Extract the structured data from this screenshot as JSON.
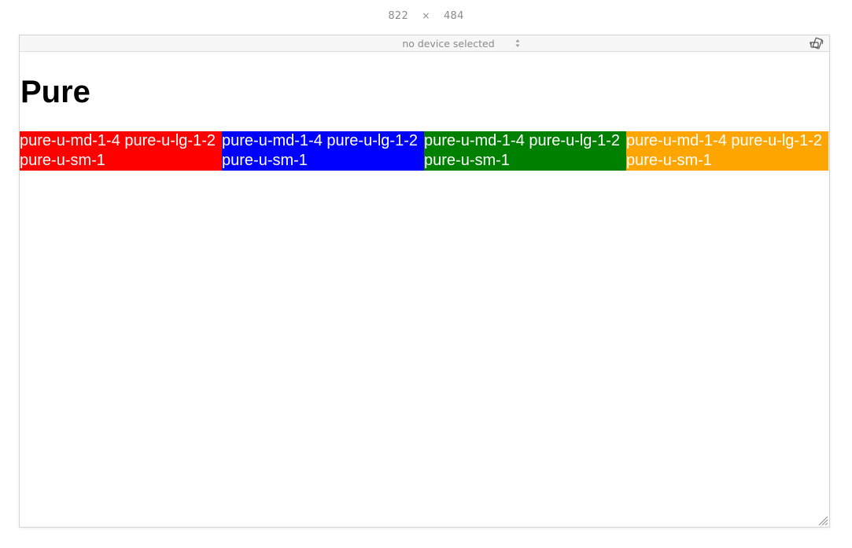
{
  "responsive_bar": {
    "width": "822",
    "separator": "×",
    "height": "484",
    "device_select": "no device selected"
  },
  "page": {
    "title": "Pure",
    "cells": [
      {
        "line1": "pure-u-md-1-4 pure-u-lg-1-2",
        "line2": "pure-u-sm-1",
        "color": "#ff0000"
      },
      {
        "line1": "pure-u-md-1-4 pure-u-lg-1-2",
        "line2": "pure-u-sm-1",
        "color": "#0000ff"
      },
      {
        "line1": "pure-u-md-1-4 pure-u-lg-1-2",
        "line2": "pure-u-sm-1",
        "color": "#008000"
      },
      {
        "line1": "pure-u-md-1-4 pure-u-lg-1-2",
        "line2": "pure-u-sm-1",
        "color": "#ffa500"
      }
    ]
  },
  "icons": {
    "rotate": "rotate-device-icon",
    "select_arrows": "select-arrows-icon",
    "resize": "resize-grip-icon"
  }
}
